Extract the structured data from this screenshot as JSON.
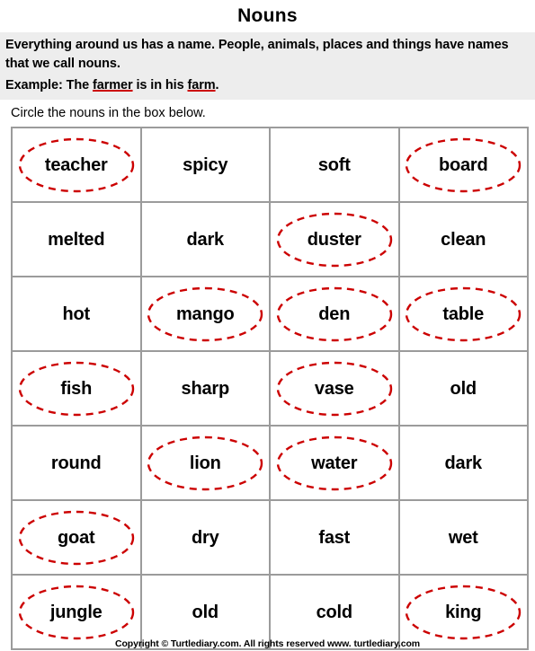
{
  "worksheet": {
    "title": "Nouns",
    "intro": {
      "line1": "Everything around us has a name. People, animals, places and things have names that we call nouns.",
      "example_prefix": "Example: The ",
      "example_word1": "farmer",
      "example_middle": " is in his ",
      "example_word2": "farm",
      "example_suffix": "."
    },
    "directions": "Circle the nouns in the box below.",
    "footer": "Copyright © Turtlediary.com. All rights reserved   www. turtlediary.com"
  },
  "colors": {
    "circle_red": "#cc0000",
    "grid_border": "#9b9b9b",
    "intro_background": "#ededed"
  },
  "grid": {
    "columns": 4,
    "rows": 7,
    "cells": [
      {
        "word": "teacher",
        "circled": true
      },
      {
        "word": "spicy",
        "circled": false
      },
      {
        "word": "soft",
        "circled": false
      },
      {
        "word": "board",
        "circled": true
      },
      {
        "word": "melted",
        "circled": false
      },
      {
        "word": "dark",
        "circled": false
      },
      {
        "word": "duster",
        "circled": true
      },
      {
        "word": "clean",
        "circled": false
      },
      {
        "word": "hot",
        "circled": false
      },
      {
        "word": "mango",
        "circled": true
      },
      {
        "word": "den",
        "circled": true
      },
      {
        "word": "table",
        "circled": true
      },
      {
        "word": "fish",
        "circled": true
      },
      {
        "word": "sharp",
        "circled": false
      },
      {
        "word": "vase",
        "circled": true
      },
      {
        "word": "old",
        "circled": false
      },
      {
        "word": "round",
        "circled": false
      },
      {
        "word": "lion",
        "circled": true
      },
      {
        "word": "water",
        "circled": true
      },
      {
        "word": "dark",
        "circled": false
      },
      {
        "word": "goat",
        "circled": true
      },
      {
        "word": "dry",
        "circled": false
      },
      {
        "word": "fast",
        "circled": false
      },
      {
        "word": "wet",
        "circled": false
      },
      {
        "word": "jungle",
        "circled": true
      },
      {
        "word": "old",
        "circled": false
      },
      {
        "word": "cold",
        "circled": false
      },
      {
        "word": "king",
        "circled": true
      }
    ]
  }
}
